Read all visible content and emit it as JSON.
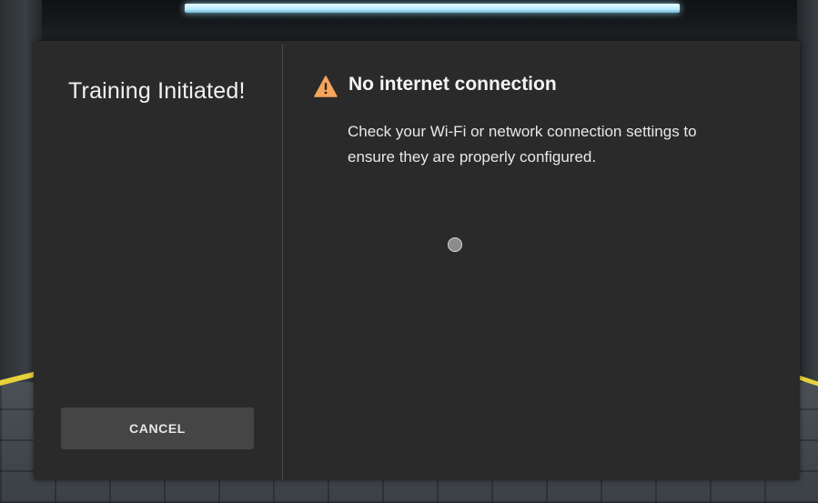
{
  "dialog": {
    "title": "Training Initiated!",
    "cancel_label": "CANCEL"
  },
  "error": {
    "icon": "warning-triangle-icon",
    "heading": "No internet connection",
    "message": "Check your Wi-Fi or network connection settings to ensure they are properly configured."
  },
  "colors": {
    "warning": "#f6a55b",
    "panel_bg": "#2a2a2a",
    "button_bg": "#454545"
  }
}
